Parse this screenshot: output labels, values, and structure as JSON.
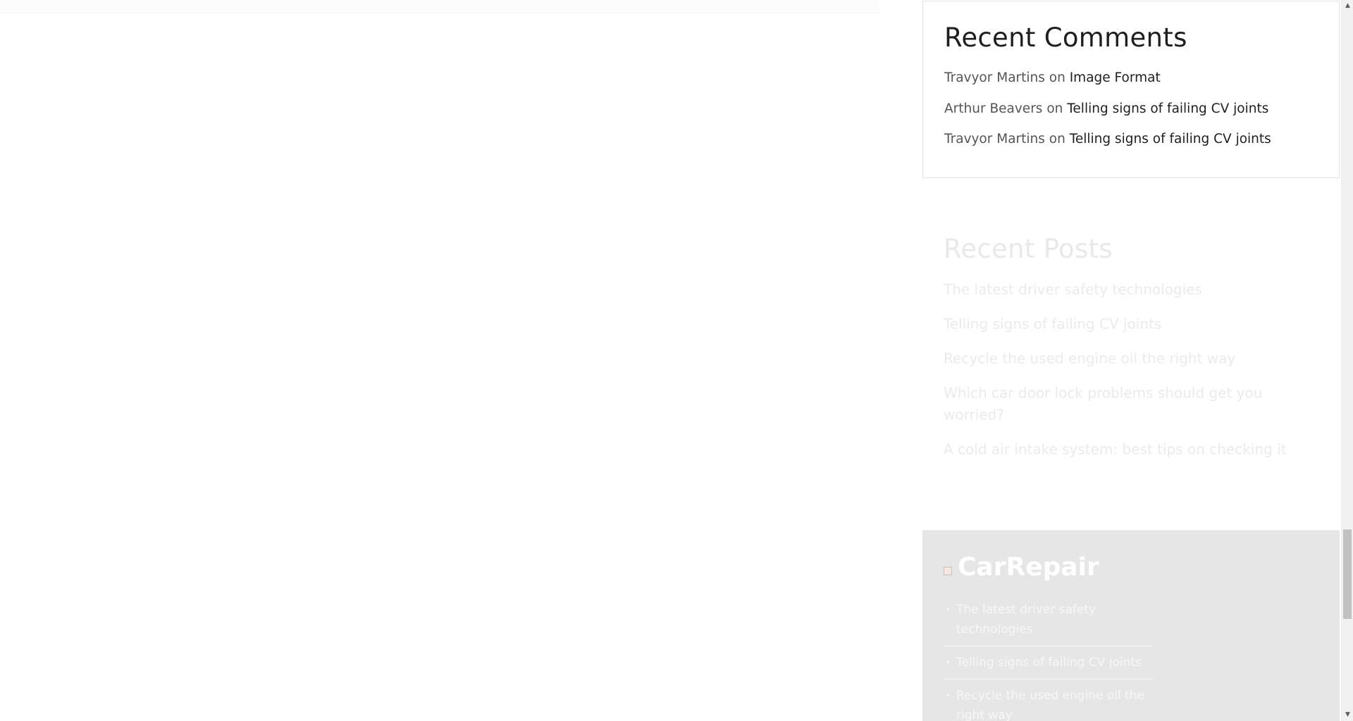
{
  "recent_comments": {
    "title": "Recent Comments",
    "items": [
      {
        "author": "Travyor Martins",
        "on": "on",
        "post": "Image Format"
      },
      {
        "author": "Arthur Beavers",
        "on": "on",
        "post": "Telling signs of failing CV joints"
      },
      {
        "author": "Travyor Martins",
        "on": "on",
        "post": "Telling signs of failing CV joints"
      }
    ]
  },
  "recent_posts": {
    "title": "Recent Posts",
    "items": [
      "The latest driver safety technologies",
      "Telling signs of failing CV joints",
      "Recycle the used engine oil the right way",
      "Which car door lock problems should get you worried?",
      "A cold air intake system: best tips on checking it"
    ]
  },
  "footer": {
    "logo_text": "CarRepair",
    "links": [
      "The latest driver safety technologies",
      "Telling signs of failing CV joints",
      "Recycle the used engine oil the right way"
    ],
    "bullet": "•"
  },
  "scrollbar": {
    "up_arrow": "▲",
    "down_arrow": "▼",
    "position": 0.85
  },
  "icons": {
    "logo": "broken-image-icon",
    "scroll_up": "triangle-up-icon",
    "scroll_down": "triangle-down-icon"
  }
}
